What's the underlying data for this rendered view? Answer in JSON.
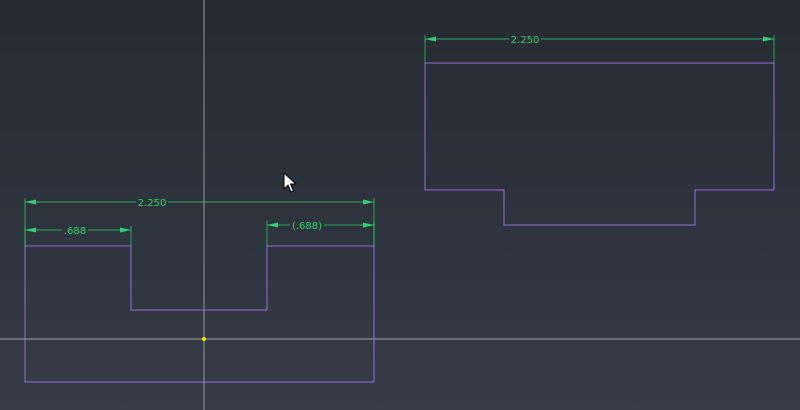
{
  "viewport": {
    "background_top": "#262b33",
    "background_bottom": "#363d47",
    "axis_color": "#b9bfc7",
    "origin_color": "#f2e600"
  },
  "colors": {
    "sketch_line": "#8f6fe0",
    "dimension": "#2fd16a"
  },
  "sketch_left": {
    "overall_width_dim": "2.250",
    "left_step_dim": ".688",
    "right_step_dim": "(.688)"
  },
  "sketch_right": {
    "overall_width_dim": "2.250"
  },
  "cursor": {
    "icon": "arrow-pointer-icon"
  }
}
